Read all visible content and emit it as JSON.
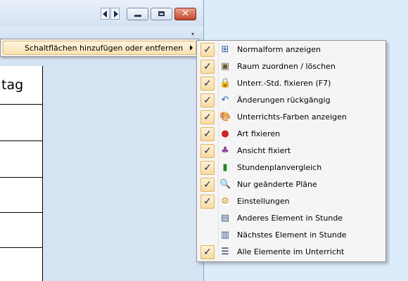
{
  "window": {
    "close_glyph": "✕",
    "column_header": "tag"
  },
  "submenu_parent": {
    "label": "Schaltflächen hinzufügen oder entfernen"
  },
  "menu_items": [
    {
      "label": "Normalform anzeigen",
      "checked": true,
      "icon": "normal-form-icon",
      "glyph": "⊞",
      "color": "#2a5aa0"
    },
    {
      "label": "Raum zuordnen / löschen",
      "checked": true,
      "icon": "room-assign-icon",
      "glyph": "▣",
      "color": "#6a5a3a"
    },
    {
      "label": "Unterr.-Std. fixieren (F7)",
      "checked": true,
      "icon": "lock-icon",
      "glyph": "🔒",
      "color": "#c8a020"
    },
    {
      "label": "Änderungen rückgängig",
      "checked": true,
      "icon": "undo-icon",
      "glyph": "↶",
      "color": "#2a6ab0"
    },
    {
      "label": "Unterrichts-Farben anzeigen",
      "checked": true,
      "icon": "palette-icon",
      "glyph": "🎨",
      "color": "#a08040"
    },
    {
      "label": "Art fixieren",
      "checked": true,
      "icon": "pin-icon",
      "glyph": "●",
      "color": "#d02020"
    },
    {
      "label": "Ansicht fixiert",
      "checked": true,
      "icon": "view-fixed-icon",
      "glyph": "♣",
      "color": "#8a40a0"
    },
    {
      "label": "Stundenplanvergleich",
      "checked": true,
      "icon": "traffic-light-icon",
      "glyph": "▮",
      "color": "#208a20"
    },
    {
      "label": "Nur geänderte Pläne",
      "checked": true,
      "icon": "changed-plans-icon",
      "glyph": "🔍",
      "color": "#3a5a8a"
    },
    {
      "label": "Einstellungen",
      "checked": true,
      "icon": "settings-gear-icon",
      "glyph": "⚙",
      "color": "#c8a020"
    },
    {
      "label": "Anderes Element in Stunde",
      "checked": false,
      "icon": "other-element-icon",
      "glyph": "▤",
      "color": "#3a5a8a"
    },
    {
      "label": "Nächstes Element in Stunde",
      "checked": false,
      "icon": "next-element-icon",
      "glyph": "▥",
      "color": "#3a5a8a"
    },
    {
      "label": "Alle Elemente im Unterricht",
      "checked": true,
      "icon": "all-elements-icon",
      "glyph": "☰",
      "color": "#1a2a4a"
    }
  ],
  "check_glyph": "✓"
}
